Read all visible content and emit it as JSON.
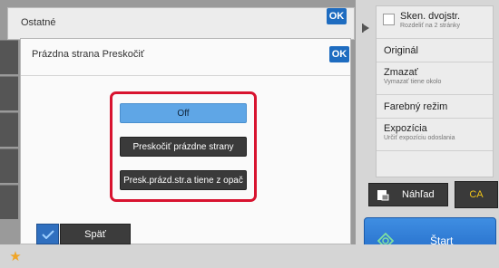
{
  "main": {
    "title": "Ostatné",
    "ok_label": "OK"
  },
  "dialog": {
    "title": "Prázdna strana Preskočiť",
    "ok_label": "OK",
    "options": [
      {
        "label": "Off",
        "selected": true
      },
      {
        "label": "Preskočiť prázdne strany",
        "selected": false
      },
      {
        "label": "Presk.prázd.str.a tiene z opač",
        "selected": false
      }
    ]
  },
  "bottom": {
    "back_label": "Späť"
  },
  "right_panel": {
    "items": [
      {
        "title": "Sken. dvojstr.",
        "subtitle": "Rozdeliť na 2 stránky"
      },
      {
        "title": "Originál",
        "subtitle": ""
      },
      {
        "title": "Zmazať",
        "subtitle": "Vymazať tiene okolo"
      },
      {
        "title": "Farebný režim",
        "subtitle": ""
      },
      {
        "title": "Expozícia",
        "subtitle": "Určiť expozíciu odoslania"
      }
    ],
    "preview_label": "Náhľad",
    "ca_label": "CA",
    "start_label": "Štart"
  },
  "colors": {
    "ok_blue": "#1e6cc0",
    "selected_option": "#5fa6e6",
    "highlight_frame": "#d8132f",
    "start_blue": "#2f7ad6",
    "ca_text": "#f0c419"
  },
  "icons": [
    "play-arrow-icon",
    "star-icon",
    "checkmark-icon",
    "scanner-icon",
    "start-diamond-icon"
  ]
}
